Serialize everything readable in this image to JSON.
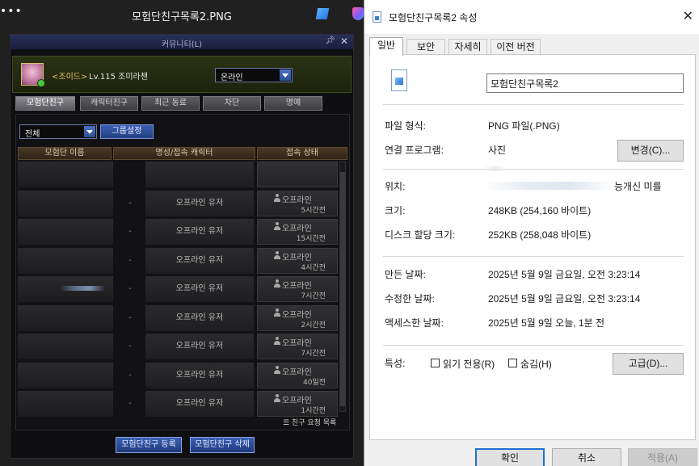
{
  "viewer": {
    "dots": "•••",
    "title": "모험단친구목록2.PNG",
    "icons": [
      "edit-image-icon",
      "copilot-icon"
    ]
  },
  "game": {
    "title": "커뮤니티(L)",
    "icons": [
      "pin-icon",
      "close-icon"
    ],
    "profile": {
      "guild": "<조이드>",
      "level_name": "Lv.115 조미라챈",
      "status": "온라인"
    },
    "tabs": [
      "모험단친구",
      "캐릭터친구",
      "최근 동료",
      "차단",
      "명예"
    ],
    "group_filter": "전체",
    "group_settings": "그룹설정",
    "columns": [
      "모험단 이름",
      "명성/접속 캐릭터",
      "접속 상태"
    ],
    "rows": [
      {
        "rep": "",
        "char": "",
        "status": "",
        "ago": ""
      },
      {
        "rep": "-",
        "char": "오프라인 유저",
        "status": "오프라인",
        "ago": "5시간전"
      },
      {
        "rep": "-",
        "char": "오프라인 유저",
        "status": "오프라인",
        "ago": "15시간전"
      },
      {
        "rep": "-",
        "char": "오프라인 유저",
        "status": "오프라인",
        "ago": "4시간전"
      },
      {
        "rep": "-",
        "char": "오프라인 유저",
        "status": "오프라인",
        "ago": "7시간전"
      },
      {
        "rep": "-",
        "char": "오프라인 유저",
        "status": "오프라인",
        "ago": "2시간전"
      },
      {
        "rep": "-",
        "char": "오프라인 유저",
        "status": "오프라인",
        "ago": "7시간전"
      },
      {
        "rep": "-",
        "char": "오프라인 유저",
        "status": "오프라인",
        "ago": "40일전"
      },
      {
        "rep": "-",
        "char": "오프라인 유저",
        "status": "오프라인",
        "ago": "1시간전"
      }
    ],
    "request_list": "☰ 친구 요청 목록",
    "add_button": "모험단친구 등록",
    "delete_button": "모험단친구 삭제"
  },
  "dialog": {
    "title": "모험단친구목록2 속성",
    "tabs": [
      "일반",
      "보안",
      "자세히",
      "이전 버전"
    ],
    "file_name": "모험단친구목록2",
    "file_type_label": "파일 형식:",
    "file_type": "PNG 파일(.PNG)",
    "opens_with_label": "연결 프로그램:",
    "opens_with": "사진",
    "change_button": "변경(C)...",
    "location_label": "위치:",
    "location": "능개신 미를",
    "size_label": "크기:",
    "size": "248KB (254,160 바이트)",
    "disk_size_label": "디스크 할당 크기:",
    "disk_size": "252KB (258,048 바이트)",
    "created_label": "만든 날짜:",
    "created": "2025년 5월 9일 금요일, 오전 3:23:14",
    "modified_label": "수정한 날짜:",
    "modified": "2025년 5월 9일 금요일, 오전 3:23:14",
    "accessed_label": "액세스한 날짜:",
    "accessed": "2025년 5월 9일 오늘, 1분 전",
    "attributes_label": "특성:",
    "readonly_label": "읽기 전용(R)",
    "hidden_label": "숨김(H)",
    "advanced_button": "고급(D)...",
    "ok_button": "확인",
    "cancel_button": "취소",
    "apply_button": "적용(A)"
  }
}
